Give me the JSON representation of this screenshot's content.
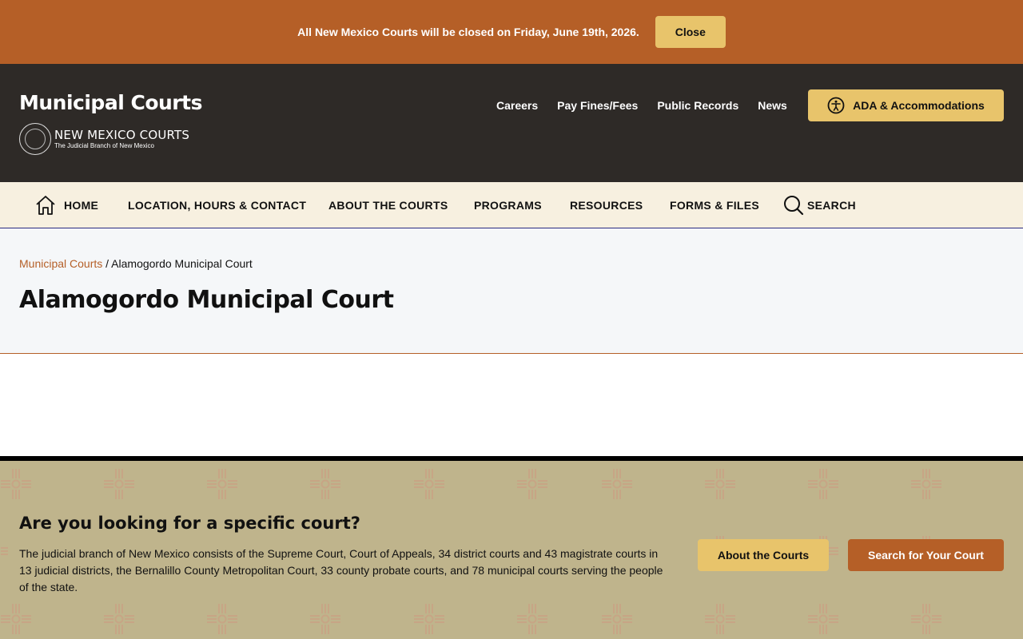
{
  "alert": {
    "message": "All New Mexico Courts will be closed on Friday, June 19th, 2026.",
    "close_label": "Close"
  },
  "header": {
    "site_title": "Municipal Courts",
    "logo_main": "NEW MEXICO COURTS",
    "logo_sub": "The Judicial Branch of New Mexico",
    "top_nav": [
      "Careers",
      "Pay Fines/Fees",
      "Public Records",
      "News"
    ],
    "ada_label": "ADA & Accommodations"
  },
  "main_nav": {
    "home": "HOME",
    "location": "LOCATION, HOURS & CONTACT",
    "about": "ABOUT THE COURTS",
    "programs": "PROGRAMS",
    "resources": "RESOURCES",
    "forms": "FORMS & FILES",
    "search": "SEARCH"
  },
  "breadcrumb": {
    "parent": "Municipal Courts",
    "separator": " / ",
    "current": "Alamogordo Municipal Court"
  },
  "page": {
    "title": "Alamogordo Municipal Court"
  },
  "cta": {
    "title": "Are you looking for a specific court?",
    "text": "The judicial branch of New Mexico consists of the Supreme Court, Court of Appeals, 34 district courts and 43 magistrate courts in 13 judicial districts, the Bernalillo County Metropolitan Court, 33 county probate courts, and 78 municipal courts serving the people of the state.",
    "about_label": "About the Courts",
    "search_label": "Search for Your Court"
  },
  "colors": {
    "accent": "#b55f27",
    "gold": "#e8c46b",
    "header_bg": "#2e2a27",
    "nav_bg": "#f7f0e0",
    "cta_bg": "#bfb48c"
  },
  "icons": {
    "home": "home-icon",
    "search": "search-icon",
    "accessibility": "accessibility-icon",
    "seal": "court-seal-icon",
    "pattern": "zia-sun-icon"
  }
}
